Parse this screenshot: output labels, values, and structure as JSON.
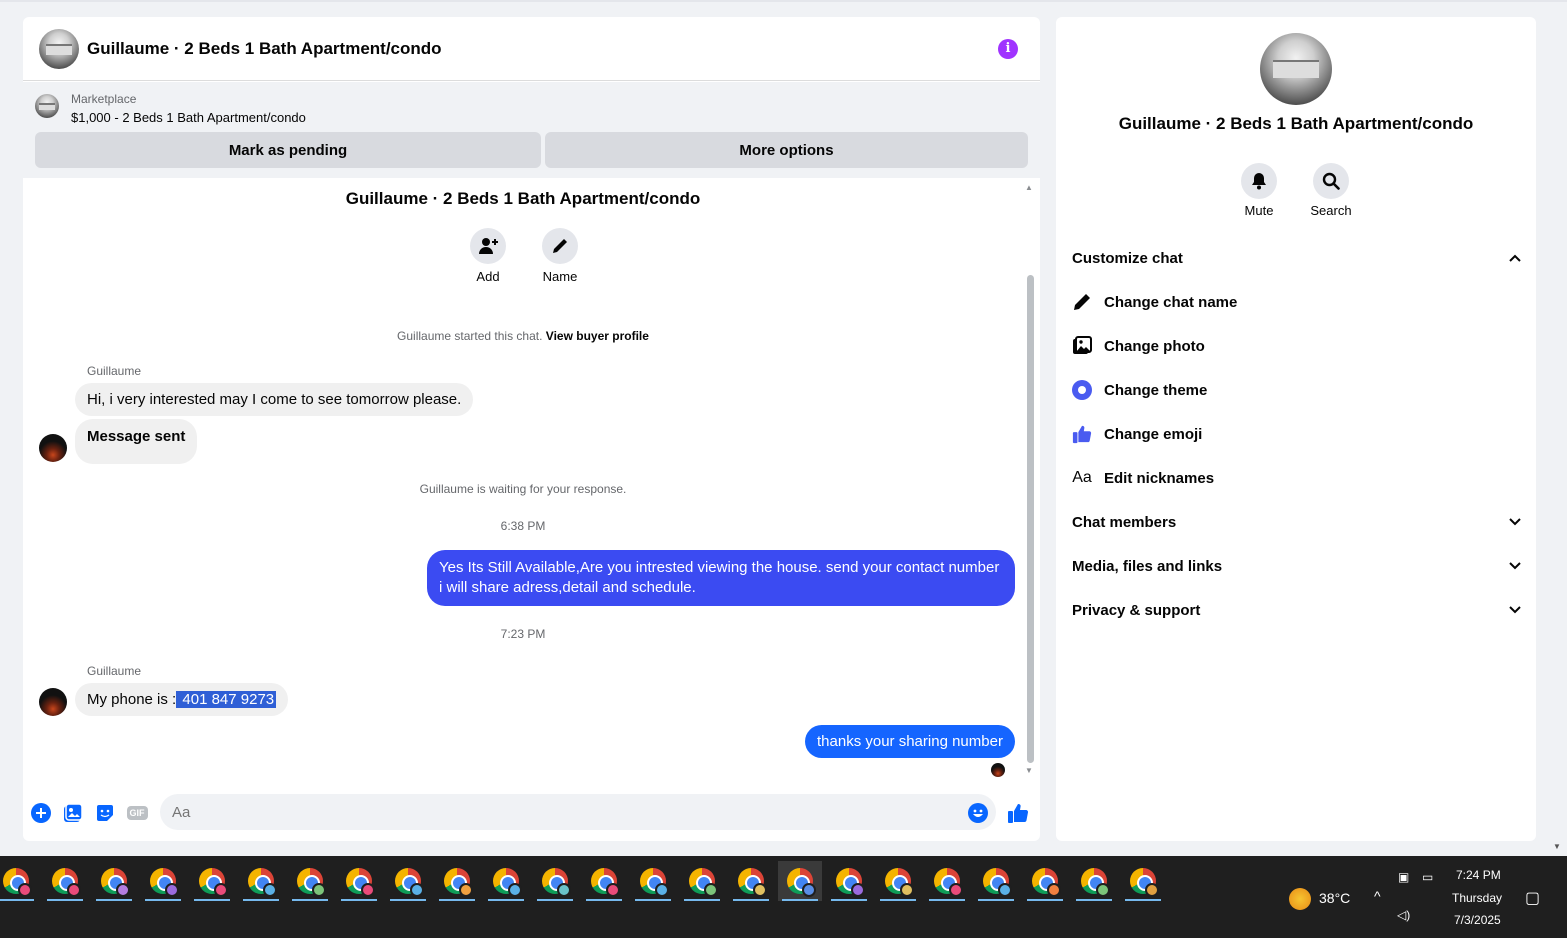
{
  "chat": {
    "header_title": "Guillaume · 2 Beds 1 Bath Apartment/condo",
    "marketplace_label": "Marketplace",
    "marketplace_item": "$1,000 - 2 Beds 1 Bath Apartment/condo",
    "mark_pending_label": "Mark as pending",
    "more_options_label": "More options",
    "conversation_title": "Guillaume · 2 Beds 1 Bath Apartment/condo",
    "add_label": "Add",
    "name_label": "Name",
    "started_text": "Guillaume started this chat.",
    "view_profile_link": "View buyer profile",
    "messages": [
      {
        "sender": "Guillaume",
        "text": "Hi, i very interested  may I come to see tomorrow please."
      },
      {
        "text": "Message sent"
      },
      {
        "system": "Guillaume is waiting for your response."
      },
      {
        "time": "6:38 PM"
      },
      {
        "outgoing": "Yes Its Still Available,Are you intrested viewing the house. send your contact number i will share adress,detail and schedule."
      },
      {
        "time": "7:23 PM"
      },
      {
        "sender": "Guillaume",
        "prefix": "My phone is :",
        "highlight": " 401  847 9273"
      },
      {
        "outgoing": "thanks your sharing number"
      }
    ],
    "composer_placeholder": "Aa"
  },
  "info": {
    "title": "Guillaume · 2 Beds 1 Bath Apartment/condo",
    "mute_label": "Mute",
    "search_label": "Search",
    "customize_label": "Customize chat",
    "menu": [
      {
        "label": "Change chat name",
        "icon": "pencil-icon"
      },
      {
        "label": "Change photo",
        "icon": "photo-icon"
      },
      {
        "label": "Change theme",
        "icon": "theme-icon"
      },
      {
        "label": "Change emoji",
        "icon": "thumbs-up-icon"
      },
      {
        "label": "Edit nicknames",
        "icon": "nickname-icon"
      }
    ],
    "sections": [
      "Chat members",
      "Media, files and links",
      "Privacy & support"
    ]
  },
  "taskbar": {
    "app_count": 24,
    "temperature": "38°C",
    "time": "7:24 PM",
    "day": "Thursday",
    "date": "7/3/2025"
  },
  "colors": {
    "accent_purple": "#a033ff",
    "bubble_blue": "#3b4bf2",
    "bubble_blue2": "#1565ff",
    "messenger_blue": "#0866ff"
  }
}
